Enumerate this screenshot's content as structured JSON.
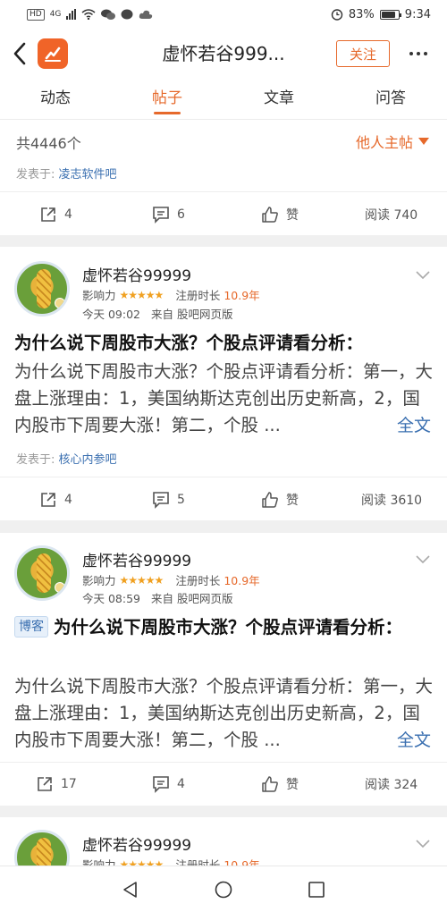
{
  "status_bar": {
    "network_badge": "HD",
    "network_type": "4G",
    "battery": "83%",
    "battery_level": 0.83,
    "time": "9:34"
  },
  "header": {
    "title": "虚怀若谷999...",
    "follow_label": "关注",
    "accent_color": "#e6692b"
  },
  "tabs": [
    {
      "label": "动态",
      "active": false
    },
    {
      "label": "帖子",
      "active": true
    },
    {
      "label": "文章",
      "active": false
    },
    {
      "label": "问答",
      "active": false
    }
  ],
  "list_header": {
    "count": "共4446个",
    "filter_label": "他人主帖"
  },
  "top_partial_card": {
    "posted_prefix": "发表于:",
    "bar": "凌志软件吧",
    "share": "4",
    "comments": "6",
    "like": "赞",
    "reads": "阅读 740"
  },
  "posts": [
    {
      "author": "虚怀若谷99999",
      "influence_label": "影响力",
      "stars": "★★★★★",
      "reg_label": "注册时长",
      "reg_years": "10.9年",
      "time": "今天 09:02",
      "source": "来自 股吧网页版",
      "tag": "",
      "title": "为什么说下周股市大涨？个股点评请看分析：",
      "body": "为什么说下周股市大涨？个股点评请看分析：第一，大盘上涨理由：1，美国纳斯达克创出历史新高，2，国内股市下周要大涨！第二，个股 ...",
      "more": "全文",
      "posted_prefix": "发表于:",
      "bar": "核心内参吧",
      "share": "4",
      "comments": "5",
      "like": "赞",
      "reads": "阅读 3610"
    },
    {
      "author": "虚怀若谷99999",
      "influence_label": "影响力",
      "stars": "★★★★★",
      "reg_label": "注册时长",
      "reg_years": "10.9年",
      "time": "今天 08:59",
      "source": "来自 股吧网页版",
      "tag": "博客",
      "title": "为什么说下周股市大涨？个股点评请看分析：",
      "body": "为什么说下周股市大涨？个股点评请看分析：第一，大盘上涨理由：1，美国纳斯达克创出历史新高，2，国内股市下周要大涨！第二，个股 ...",
      "more": "全文",
      "share": "17",
      "comments": "4",
      "like": "赞",
      "reads": "阅读 324"
    },
    {
      "author": "虚怀若谷99999",
      "influence_label": "影响力",
      "stars": "★★★★★",
      "reg_label": "注册时长",
      "reg_years": "10.9年"
    }
  ]
}
